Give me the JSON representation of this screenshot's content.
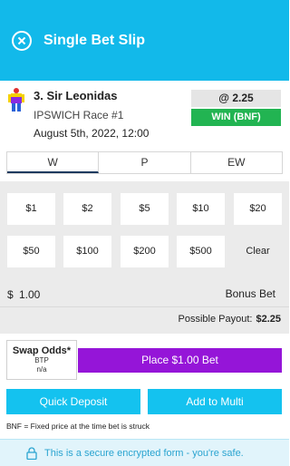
{
  "header": {
    "title": "Single Bet Slip",
    "close_icon": "close-circle-icon"
  },
  "selection": {
    "runner": "3. Sir Leonidas",
    "race": "IPSWICH Race #1",
    "date": "August 5th, 2022, 12:00",
    "odds": "@ 2.25",
    "bet_type": "WIN (BNF)",
    "bet_type_color": "#22b452",
    "silks_icon": "jockey-silks-icon"
  },
  "tabs": [
    {
      "label": "W",
      "active": true
    },
    {
      "label": "P",
      "active": false
    },
    {
      "label": "EW",
      "active": false
    }
  ],
  "stake_buttons": [
    "$1",
    "$2",
    "$5",
    "$10",
    "$20",
    "$50",
    "$100",
    "$200",
    "$500"
  ],
  "clear_label": "Clear",
  "stake": {
    "currency": "$",
    "value": "1.00",
    "bonus_label": "Bonus Bet"
  },
  "payout": {
    "label": "Possible Payout:",
    "value": "$2.25"
  },
  "swap": {
    "title": "Swap Odds*",
    "line1": "BTP",
    "line2": "n/a"
  },
  "place_button": {
    "label": "Place $1.00 Bet",
    "color": "#9515d8"
  },
  "quick_deposit": "Quick Deposit",
  "add_to_multi": "Add to Multi",
  "bnf_note": "BNF = Fixed price at the time bet is struck",
  "secure": {
    "text": "This is a secure encrypted form - you're safe.",
    "icon": "lock-icon"
  },
  "colors": {
    "primary": "#12b9ea",
    "accent_purple": "#9515d8",
    "success_green": "#22b452"
  }
}
